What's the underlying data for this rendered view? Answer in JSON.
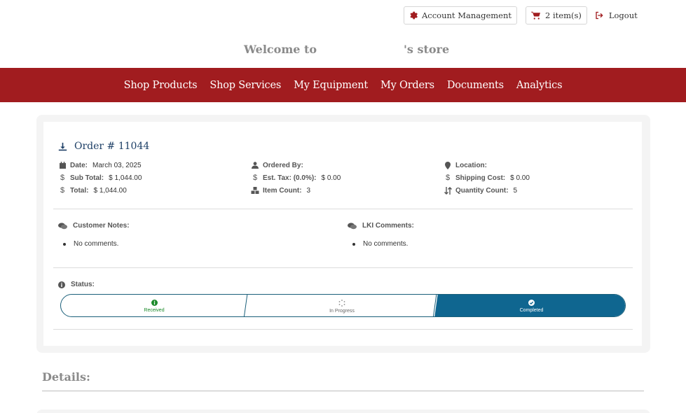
{
  "topbar": {
    "account_label": "Account Management",
    "cart_label": "2 item(s)",
    "logout_label": "Logout"
  },
  "welcome": {
    "prefix": "Welcome to",
    "suffix": "'s store"
  },
  "nav": [
    {
      "label": "Shop Products"
    },
    {
      "label": "Shop Services"
    },
    {
      "label": "My Equipment"
    },
    {
      "label": "My Orders"
    },
    {
      "label": "Documents"
    },
    {
      "label": "Analytics"
    }
  ],
  "order": {
    "title": "Order # 11044",
    "date_label": "Date:",
    "date_value": "March 03, 2025",
    "subtotal_label": "Sub Total:",
    "subtotal_value": "$ 1,044.00",
    "total_label": "Total:",
    "total_value": "$ 1,044.00",
    "ordered_by_label": "Ordered By:",
    "ordered_by_value": "",
    "tax_label": "Est. Tax: (0.0%):",
    "tax_value": "$ 0.00",
    "item_count_label": "Item Count:",
    "item_count_value": "3",
    "location_label": "Location:",
    "location_value": "",
    "shipping_label": "Shipping Cost:",
    "shipping_value": "$ 0.00",
    "quantity_label": "Quantity Count:",
    "quantity_value": "5"
  },
  "notes": {
    "customer_label": "Customer Notes:",
    "customer_items": [
      "No comments."
    ],
    "lki_label": "LKI Comments:",
    "lki_items": [
      "No comments."
    ]
  },
  "status": {
    "label": "Status:",
    "steps": [
      {
        "label": "Received",
        "state": "done"
      },
      {
        "label": "In Progress",
        "state": "pending"
      },
      {
        "label": "Completed",
        "state": "current"
      }
    ]
  },
  "details": {
    "title": "Details:"
  },
  "colors": {
    "brand": "#a11c1f",
    "navy": "#1d3f66",
    "status_blue": "#0f6690",
    "success": "#1b8a2a"
  }
}
